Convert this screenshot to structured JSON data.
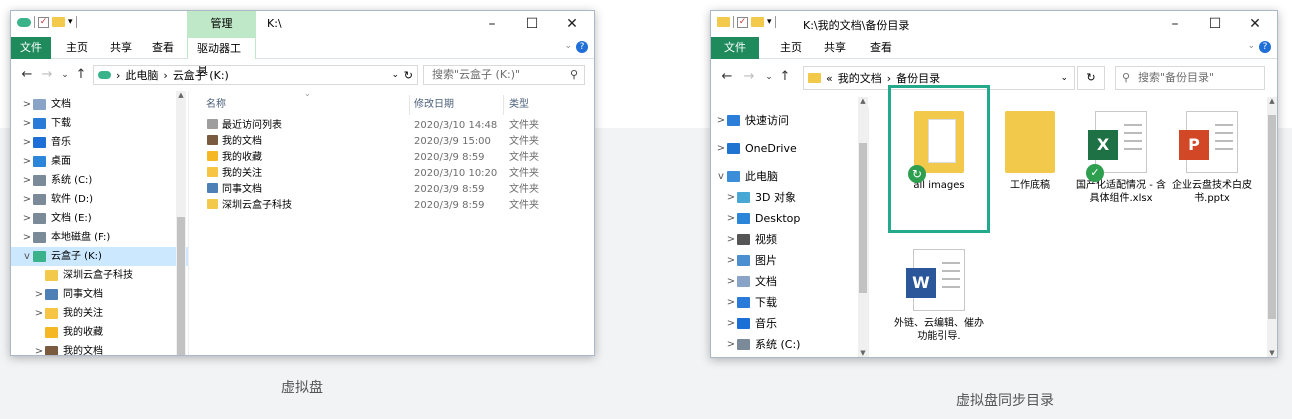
{
  "window1": {
    "ribbon_context": "管理",
    "title": "K:\\",
    "tabs": {
      "file": "文件",
      "home": "主页",
      "share": "共享",
      "view": "查看",
      "drive_tools": "驱动器工具"
    },
    "address": {
      "pc": "此电脑",
      "sep": "›",
      "drive": "云盒子 (K:)"
    },
    "search_placeholder": "搜索\"云盒子 (K:)\"",
    "nav": [
      {
        "label": "文档",
        "icon": "document-icon",
        "color": "#8aa4c8"
      },
      {
        "label": "下载",
        "icon": "download-icon",
        "color": "#2a7ad9"
      },
      {
        "label": "音乐",
        "icon": "music-icon",
        "color": "#1c6fd6"
      },
      {
        "label": "桌面",
        "icon": "desktop-icon",
        "color": "#2b86d9"
      },
      {
        "label": "系统 (C:)",
        "icon": "drive-icon",
        "color": "#7a8a99"
      },
      {
        "label": "软件 (D:)",
        "icon": "drive-icon",
        "color": "#7a8a99"
      },
      {
        "label": "文档 (E:)",
        "icon": "drive-icon",
        "color": "#7a8a99"
      },
      {
        "label": "本地磁盘 (F:)",
        "icon": "drive-icon",
        "color": "#7a8a99"
      },
      {
        "label": "云盒子 (K:)",
        "icon": "cloud-drive-icon",
        "color": "#3bb38a"
      },
      {
        "label": "深圳云盒子科技",
        "icon": "folder-icon",
        "color": "#f3c94c"
      },
      {
        "label": "同事文档",
        "icon": "shared-folder-icon",
        "color": "#4e7fb5"
      },
      {
        "label": "我的关注",
        "icon": "bulb-icon",
        "color": "#f6c543"
      },
      {
        "label": "我的收藏",
        "icon": "star-icon",
        "color": "#f5b824"
      },
      {
        "label": "我的文档",
        "icon": "user-icon",
        "color": "#7b5b40"
      }
    ],
    "columns": {
      "name": "名称",
      "date": "修改日期",
      "type": "类型"
    },
    "files": [
      {
        "name": "最近访问列表",
        "date": "2020/3/10 14:48",
        "type": "文件夹",
        "icon": "recent-icon",
        "color": "#9e9e9e"
      },
      {
        "name": "我的文档",
        "date": "2020/3/9 15:00",
        "type": "文件夹",
        "icon": "user-icon",
        "color": "#7b5b40"
      },
      {
        "name": "我的收藏",
        "date": "2020/3/9 8:59",
        "type": "文件夹",
        "icon": "star-icon",
        "color": "#f5b824"
      },
      {
        "name": "我的关注",
        "date": "2020/3/10 10:20",
        "type": "文件夹",
        "icon": "bulb-icon",
        "color": "#f6c543"
      },
      {
        "name": "同事文档",
        "date": "2020/3/9 8:59",
        "type": "文件夹",
        "icon": "shared-folder-icon",
        "color": "#4e7fb5"
      },
      {
        "name": "深圳云盒子科技",
        "date": "2020/3/9 8:59",
        "type": "文件夹",
        "icon": "folder-icon",
        "color": "#f3c94c"
      }
    ]
  },
  "window2": {
    "title": "K:\\我的文档\\备份目录",
    "tabs": {
      "file": "文件",
      "home": "主页",
      "share": "共享",
      "view": "查看"
    },
    "address": {
      "prefix": "«",
      "part1": "我的文档",
      "sep": "›",
      "part2": "备份目录"
    },
    "search_placeholder": "搜索\"备份目录\"",
    "nav": [
      {
        "label": "快速访问",
        "icon": "quick-access-icon",
        "color": "#2b7fd9"
      },
      {
        "label": "OneDrive",
        "icon": "onedrive-icon",
        "color": "#1f73d1"
      },
      {
        "label": "此电脑",
        "icon": "computer-icon",
        "color": "#3d8ed8"
      },
      {
        "label": "3D 对象",
        "icon": "3d-objects-icon",
        "color": "#49a7d6"
      },
      {
        "label": "Desktop",
        "icon": "desktop-icon",
        "color": "#2b86d9"
      },
      {
        "label": "视频",
        "icon": "video-icon",
        "color": "#555555"
      },
      {
        "label": "图片",
        "icon": "picture-icon",
        "color": "#4b8fd1"
      },
      {
        "label": "文档",
        "icon": "document-icon",
        "color": "#8aa4c8"
      },
      {
        "label": "下载",
        "icon": "download-icon",
        "color": "#2a7ad9"
      },
      {
        "label": "音乐",
        "icon": "music-icon",
        "color": "#1c6fd6"
      },
      {
        "label": "系统 (C:)",
        "icon": "drive-icon",
        "color": "#7a8a99"
      }
    ],
    "items": [
      {
        "label": "all images",
        "icon": "folder-images-icon"
      },
      {
        "label": "工作底稿",
        "icon": "folder-icon"
      },
      {
        "label": "国产化适配情况 - 含具体组件.xlsx",
        "icon": "excel-file-icon",
        "letter": "X",
        "color": "#1e7145"
      },
      {
        "label": "企业云盘技术白皮书.pptx",
        "icon": "powerpoint-file-icon",
        "letter": "P",
        "color": "#d24726"
      },
      {
        "label": "外链、云编辑、催办功能引导.",
        "icon": "word-file-icon",
        "letter": "W",
        "color": "#2b579a"
      }
    ]
  },
  "captions": {
    "left": "虚拟盘",
    "right": "虚拟盘同步目录"
  },
  "colors": {
    "ribbon_file": "#1f8a5c",
    "selection_frame": "#23a98c",
    "nav_selected": "#cce8ff"
  }
}
